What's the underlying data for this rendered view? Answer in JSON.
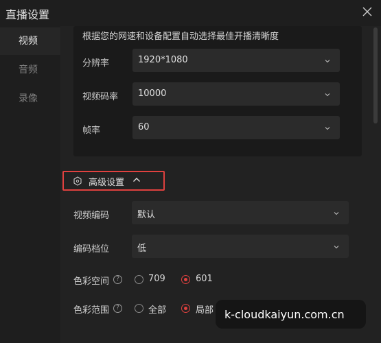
{
  "window": {
    "title": "直播设置"
  },
  "sidebar": {
    "items": [
      {
        "label": "视频"
      },
      {
        "label": "音频"
      },
      {
        "label": "录像"
      }
    ]
  },
  "auto": {
    "hint": "根据您的网速和设备配置自动选择最佳开播清晰度"
  },
  "fields": {
    "resolution": {
      "label": "分辨率",
      "value": "1920*1080"
    },
    "bitrate": {
      "label": "视频码率",
      "value": "10000"
    },
    "framerate": {
      "label": "帧率",
      "value": "60"
    }
  },
  "advanced": {
    "title": "高级设置",
    "encoder": {
      "label": "视频编码",
      "value": "默认"
    },
    "profile": {
      "label": "编码档位",
      "value": "低"
    },
    "color_space": {
      "label": "色彩空间",
      "options": [
        "709",
        "601"
      ],
      "selected": "601"
    },
    "color_range": {
      "label": "色彩范围",
      "options": [
        "全部",
        "局部"
      ],
      "selected": "局部"
    }
  },
  "watermark": {
    "text": "k-cloudkaiyun.com.cn"
  },
  "colors": {
    "accent": "#e0413f",
    "background": "#232323"
  },
  "icons": [
    "close-icon",
    "chevron-down-icon",
    "settings-hex-icon",
    "chevron-up-icon",
    "help-icon"
  ]
}
